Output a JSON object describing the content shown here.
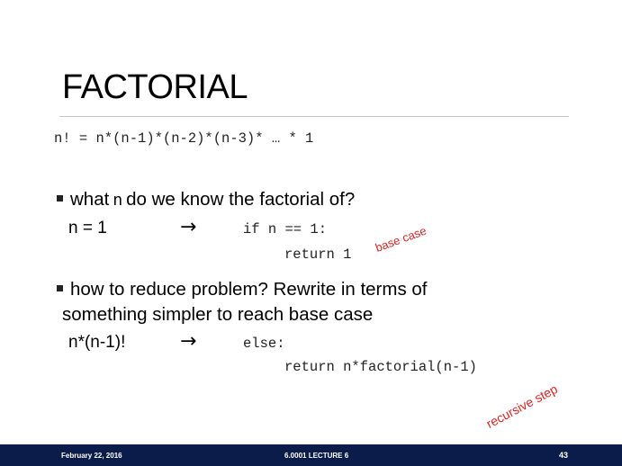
{
  "slide": {
    "title": "FACTORIAL",
    "formula": "n! = n*(n-1)*(n-2)*(n-3)* … * 1",
    "bullet1": {
      "pre": "what",
      "code": "n",
      "post": "do we know the factorial of?"
    },
    "line1": {
      "label": "n = 1",
      "arrow": "→",
      "code_if": "if n == 1:",
      "code_return": "return 1",
      "note": "base case"
    },
    "bullet2": {
      "line1": "how to reduce problem? Rewrite in terms of",
      "line2": "something simpler to reach base case"
    },
    "line2": {
      "label": "n*(n-1)!",
      "arrow": "→",
      "code_else": "else:",
      "code_return": "return n*factorial(n-1)",
      "note": "recursive step"
    }
  },
  "footer": {
    "date": "February 22, 2016",
    "course": "6.0001 LECTURE 6",
    "page": "43"
  },
  "colors": {
    "footer_bg": "#0c1c4a",
    "annotation": "#e02020"
  }
}
